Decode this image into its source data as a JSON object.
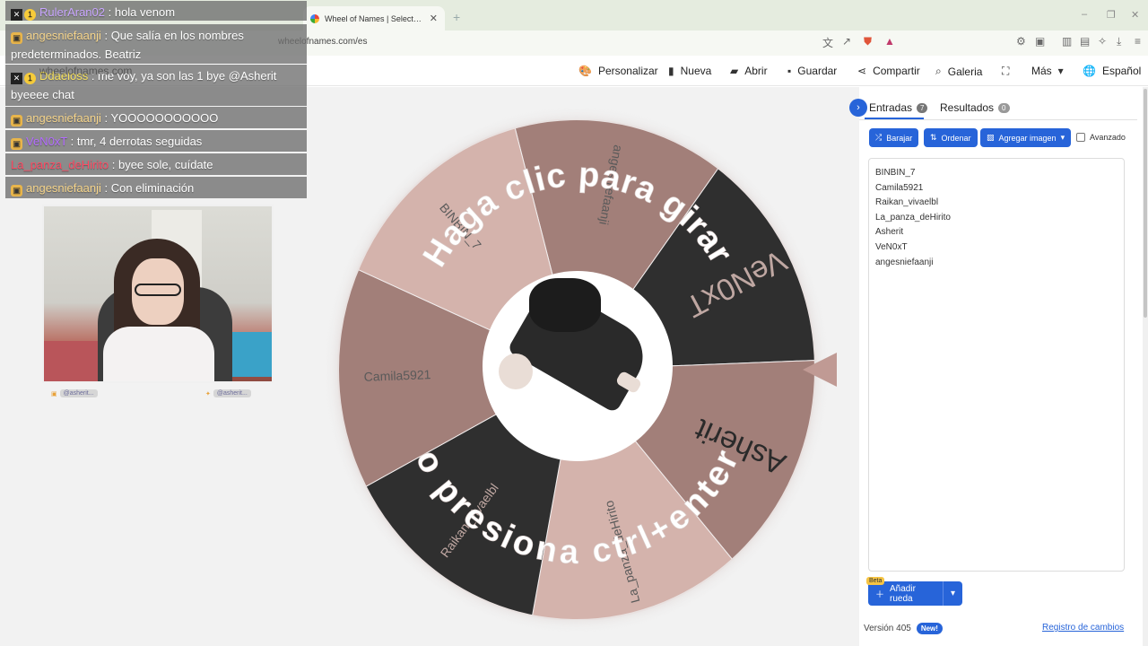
{
  "browser": {
    "tab_title": "Wheel of Names | Selector de no",
    "tab_close": "✕",
    "new_tab": "+",
    "url": "wheelofnames.com/es",
    "win_min": "–",
    "win_max": "❐",
    "win_close": "✕"
  },
  "header": {
    "menu": [
      {
        "label": "Personalizar",
        "icon": "palette-icon",
        "glyph": "🎨"
      },
      {
        "label": "Nueva",
        "icon": "file-icon",
        "glyph": "▮"
      },
      {
        "label": "Abrir",
        "icon": "folder-icon",
        "glyph": "▰"
      },
      {
        "label": "Guardar",
        "icon": "save-icon",
        "glyph": "▪"
      },
      {
        "label": "Compartir",
        "icon": "share-icon",
        "glyph": "⋖"
      },
      {
        "label": "Galeria",
        "icon": "search-icon",
        "glyph": "⌕"
      },
      {
        "label": "",
        "icon": "fullscreen-icon",
        "glyph": "⛶"
      },
      {
        "label": "Más",
        "icon": "chevron-down-icon",
        "glyph": "▾"
      },
      {
        "label": "Español",
        "icon": "globe-icon",
        "glyph": "🌐"
      }
    ]
  },
  "wheel": {
    "arc_top": "Haga clic para girar",
    "arc_bottom": "o presiona ctrl+enter",
    "colors": {
      "light": "#d4b3ac",
      "mid": "#a27f79",
      "dark": "#2f2f2f",
      "dark_text": "#bfa7a2",
      "light_text": "#5a5a5a"
    },
    "slices": [
      {
        "label": "angesniefaanji",
        "tone": "mid"
      },
      {
        "label": "VeN0xT",
        "tone": "dark"
      },
      {
        "label": "Asherit",
        "tone": "mid"
      },
      {
        "label": "La_panza_deHirito",
        "tone": "light"
      },
      {
        "label": "Raikan_vivaelbl",
        "tone": "dark"
      },
      {
        "label": "Camila5921",
        "tone": "mid"
      },
      {
        "label": "BINBIN_7",
        "tone": "light"
      }
    ]
  },
  "panel": {
    "tabs": [
      {
        "label": "Entradas",
        "count": "7"
      },
      {
        "label": "Resultados",
        "count": "0"
      }
    ],
    "buttons": {
      "shuffle": "Barajar",
      "sort": "Ordenar",
      "add_image": "Agregar imagen"
    },
    "advanced_label": "Avanzado",
    "entries": [
      "BINBIN_7",
      "Camila5921",
      "Raikan_vivaelbl",
      "La_panza_deHirito",
      "Asherit",
      "VeN0xT",
      "angesniefaanji"
    ],
    "add_wheel": "Añadir rueda",
    "beta": "Beta",
    "version": "Versión 405",
    "new_badge": "New!",
    "changelog": "Registro de cambios"
  },
  "chat": [
    {
      "user": "RulerAran02",
      "text": " : hola venom",
      "badge": "num",
      "color": "#c9a6ff"
    },
    {
      "user": "angesniefaanji",
      "text": " : Que salía en los nombres predeterminados. Beatriz",
      "badge": "ic",
      "color": "#f6d58b"
    },
    {
      "user": "Ddaeloss",
      "text": " : me voy, ya son las 1 bye @Asherit byeeee chat",
      "badge": "num",
      "color": "#f7e25c"
    },
    {
      "user": "angesniefaanji",
      "text": " : YOOOOOOOOOOO",
      "badge": "ic",
      "color": "#f6d58b"
    },
    {
      "user": "VeN0xT",
      "text": " : tmr, 4 derrotas seguidas",
      "badge": "ic",
      "color": "#b36bff"
    },
    {
      "user": "La_panza_deHirito",
      "text": " : byee sole, cuídate",
      "badge": "none",
      "color": "#ff4a63"
    },
    {
      "user": "angesniefaanji",
      "text": " : Con eliminación",
      "badge": "ic",
      "color": "#f6d58b"
    }
  ],
  "chat_overlap_text": "wheelofnames.com",
  "webcam": {
    "social": [
      {
        "icon": "kofi-icon",
        "handle": "@asherit..."
      },
      {
        "icon": "twitter-icon",
        "handle": "@asherit..."
      }
    ]
  }
}
